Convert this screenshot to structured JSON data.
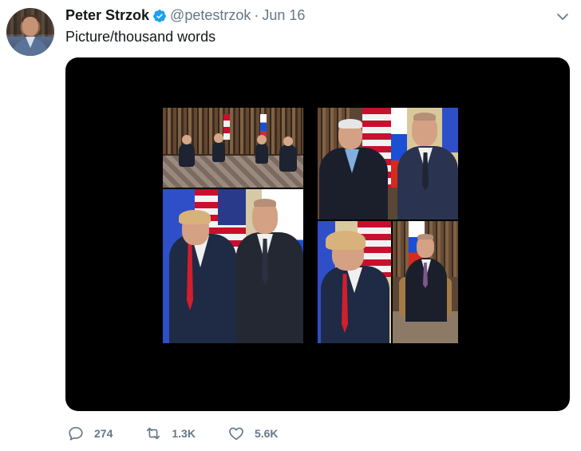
{
  "author": {
    "name": "Peter Strzok",
    "handle": "@petestrzok",
    "separator": "·",
    "date": "Jun 16",
    "verified": true
  },
  "tweet": {
    "text": "Picture/thousand words"
  },
  "stats": {
    "replies": "274",
    "retweets": "1.3K",
    "likes": "5.6K"
  },
  "icons": {
    "verified": "verified-badge-icon",
    "more": "chevron-down-icon",
    "reply": "reply-icon",
    "retweet": "retweet-icon",
    "like": "heart-icon"
  },
  "colors": {
    "accent": "#1da1f2",
    "secondary_text": "#657786",
    "media_background": "#000000"
  }
}
